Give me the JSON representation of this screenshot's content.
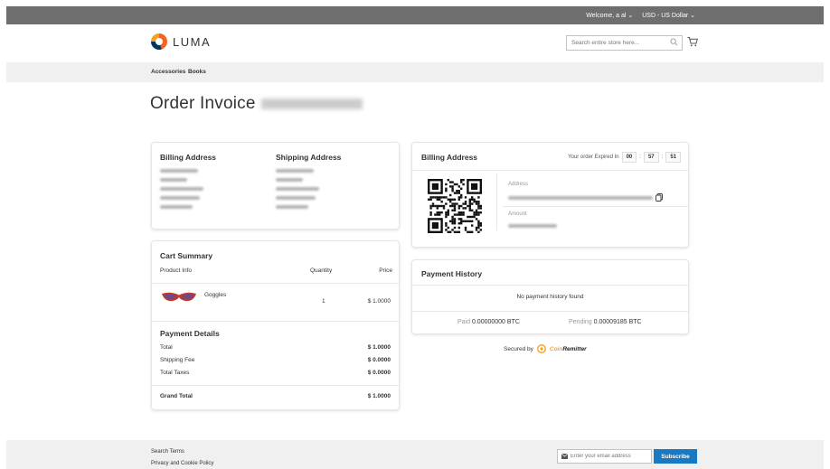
{
  "topbar": {
    "welcome": "Welcome, a al ⌄",
    "currency": "USD - US Dollar ⌄"
  },
  "header": {
    "logo_text": "LUMA",
    "search_placeholder": "Search entire store here..."
  },
  "nav": {
    "items": [
      "Accessories",
      "Books"
    ]
  },
  "page": {
    "title": "Order Invoice"
  },
  "addresses": {
    "billing_heading": "Billing Address",
    "shipping_heading": "Shipping Address"
  },
  "cart": {
    "heading": "Cart Summary",
    "columns": {
      "product": "Product Info",
      "quantity": "Quantity",
      "price": "Price"
    },
    "items": [
      {
        "name": "Goggles",
        "quantity": "1",
        "price": "$ 1.0000"
      }
    ]
  },
  "payment_details": {
    "heading": "Payment Details",
    "rows": [
      {
        "label": "Total",
        "value": "$ 1.0000"
      },
      {
        "label": "Shipping Fee",
        "value": "$ 0.0000"
      },
      {
        "label": "Total Taxes",
        "value": "$ 0.0000"
      }
    ],
    "grand_total": {
      "label": "Grand Total",
      "value": "$ 1.0000"
    }
  },
  "crypto": {
    "heading": "Billing Address",
    "expired_label": "Your order Expired In",
    "timer": {
      "h": "00",
      "m": "57",
      "s": "51"
    },
    "address_label": "Address",
    "amount_label": "Amount"
  },
  "payment_history": {
    "heading": "Payment History",
    "empty": "No payment history found",
    "paid_label": "Paid",
    "paid_value": "0.00000000 BTC",
    "pending_label": "Pending",
    "pending_value": "0.00009185 BTC"
  },
  "secured": {
    "label": "Secured by",
    "brand_a": "Coin",
    "brand_b": "Remitter"
  },
  "footer": {
    "links": [
      "Search Terms",
      "Privacy and Cookie Policy"
    ],
    "email_placeholder": "Enter your email address",
    "subscribe": "Subscribe"
  },
  "colors": {
    "accent": "#1979c3",
    "topbar": "#6e6e6e",
    "logo_orange": "#f26322",
    "coin_orange": "#f7a21b"
  }
}
